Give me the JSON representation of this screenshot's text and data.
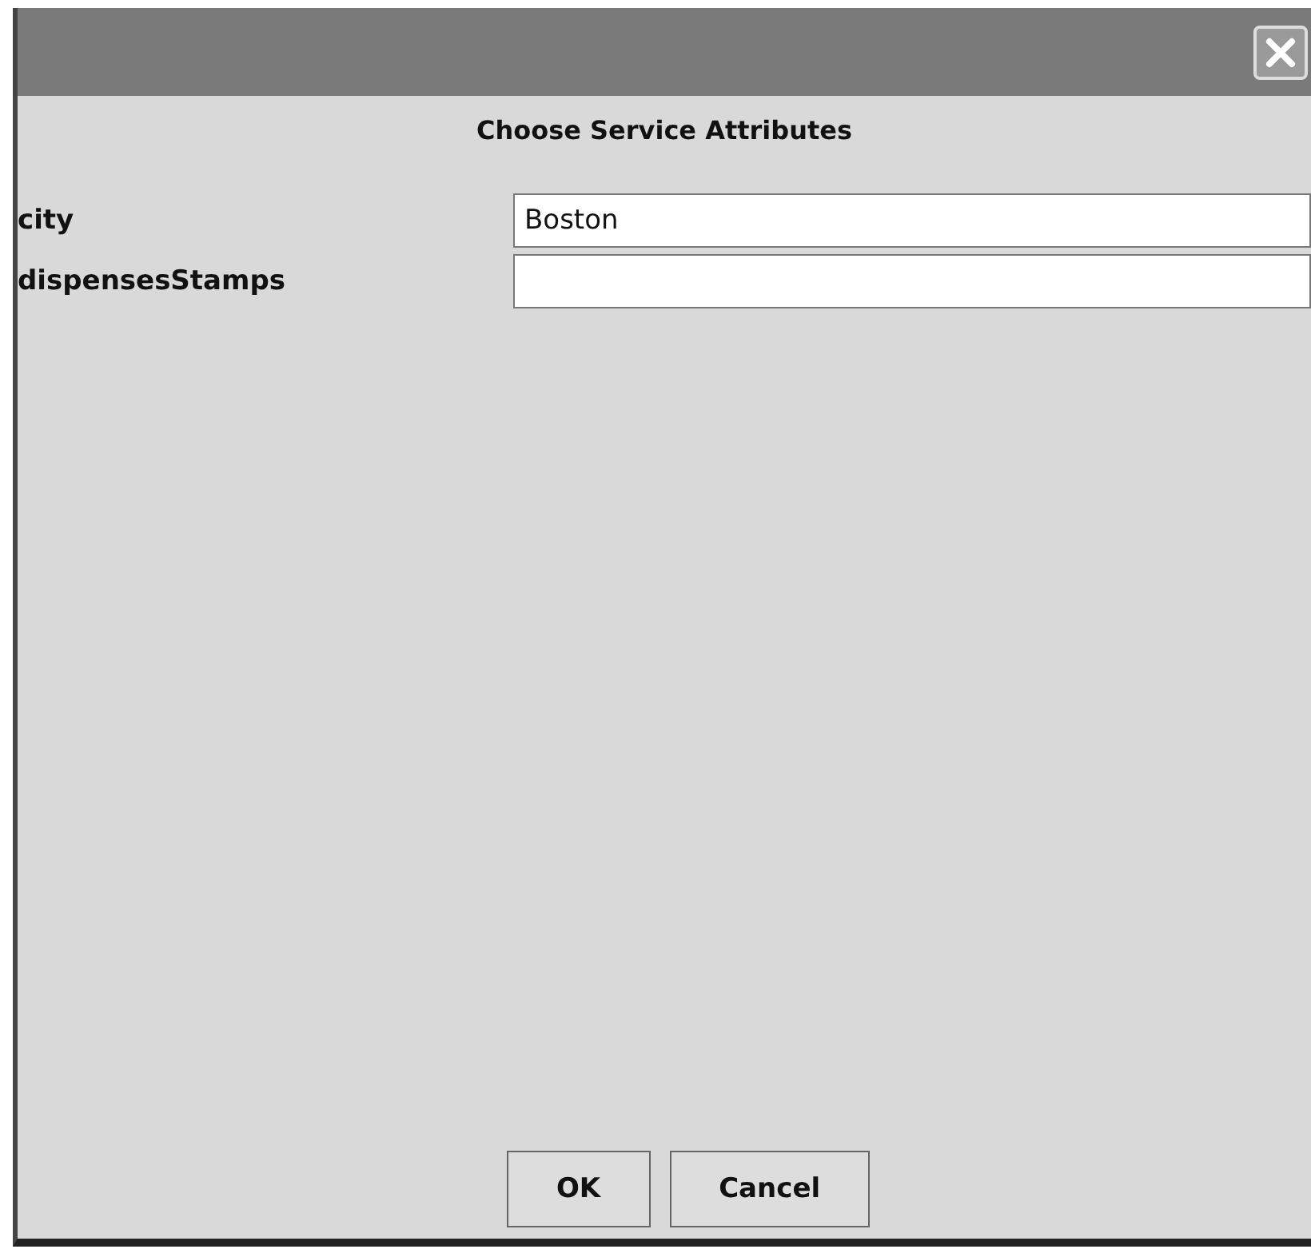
{
  "dialog": {
    "heading": "Choose Service Attributes"
  },
  "fields": [
    {
      "label": "city",
      "value": "Boston"
    },
    {
      "label": "dispensesStamps"
    }
  ],
  "buttons": [
    "OK",
    "Cancel"
  ]
}
